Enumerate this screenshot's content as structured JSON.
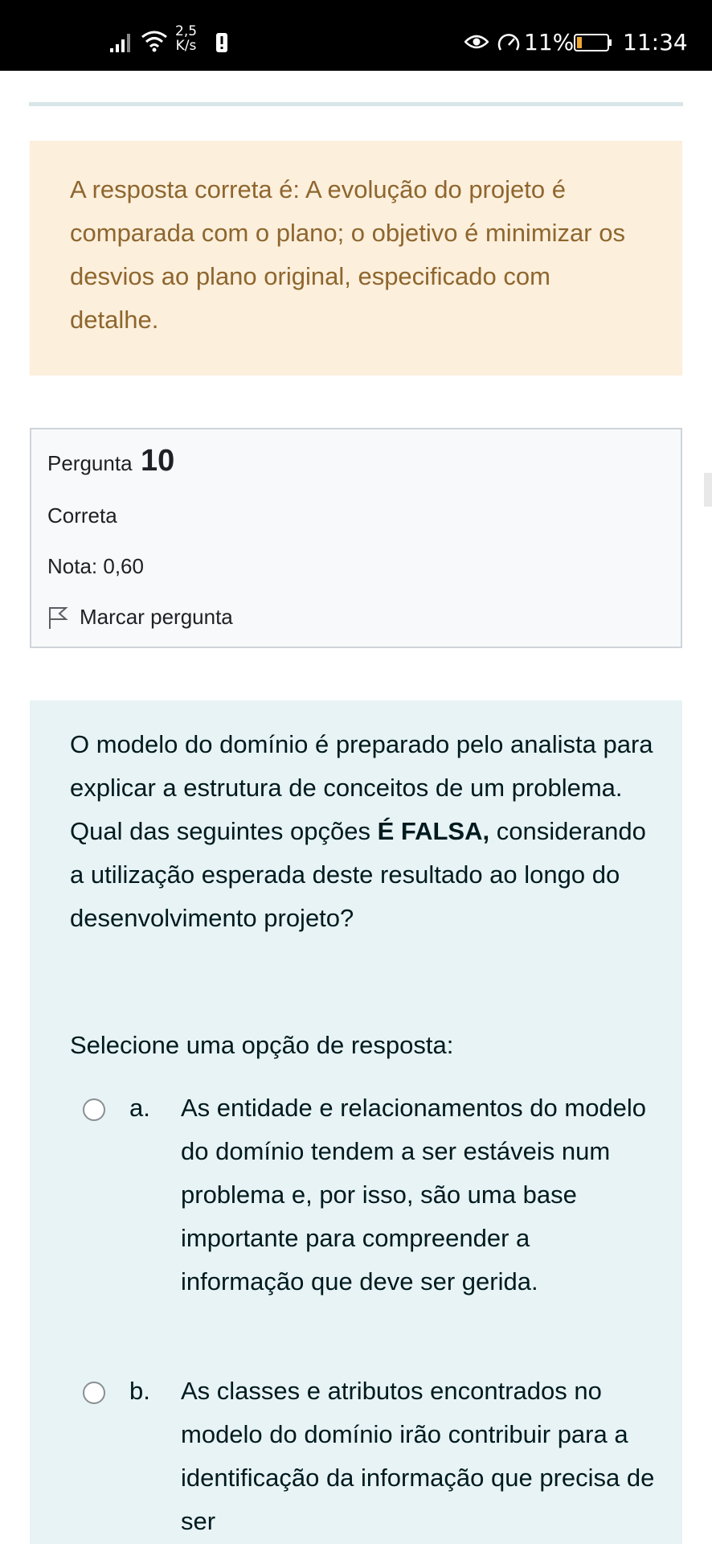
{
  "status_bar": {
    "net_speed_value": "2,5",
    "net_speed_unit": "K/s",
    "battery_percent": "11%",
    "time": "11:34"
  },
  "feedback": {
    "text": "A resposta correta é: A evolução do projeto é comparada com o plano; o objetivo é minimizar os desvios ao plano original, especificado com detalhe."
  },
  "question_info": {
    "label": "Pergunta",
    "number": "10",
    "state": "Correta",
    "grade": "Nota: 0,60",
    "flag_label": "Marcar pergunta"
  },
  "question": {
    "text_before": "O modelo do domínio é preparado pelo analista para explicar a estrutura de conceitos de um problema. Qual das seguintes opções ",
    "text_bold": "É FALSA,",
    "text_after": " considerando a utilização esperada deste resultado ao longo do desenvolvimento projeto?",
    "prompt": "Selecione uma opção de resposta:",
    "options": [
      {
        "letter": "a.",
        "text": "As entidade e relacionamentos do modelo do domínio tendem a ser estáveis num problema e, por isso, são uma base importante para compreender a informação que deve ser gerida."
      },
      {
        "letter": "b.",
        "text": "As classes e  atributos encontrados no modelo do domínio irão contribuir para a identificação da informação que precisa de ser"
      }
    ]
  }
}
